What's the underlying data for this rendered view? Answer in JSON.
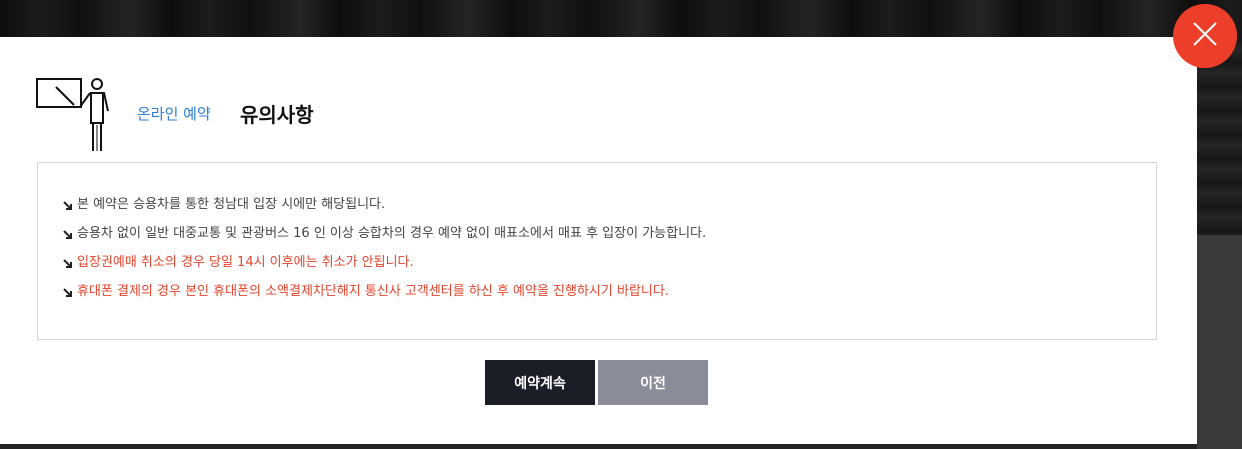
{
  "modal": {
    "section_label": "온라인 예약",
    "title": "유의사항",
    "notices": [
      {
        "text": "본 예약은 승용차를 통한 청남대 입장 시에만 해당됩니다.",
        "warning": false
      },
      {
        "text": "승용차 없이 일반 대중교통 및 관광버스 16 인 이상 승합차의 경우 예약 없이 매표소에서 매표 후 입장이 가능합니다.",
        "warning": false
      },
      {
        "text": "입장권예매 취소의 경우 당일 14시 이후에는 취소가 안됩니다.",
        "warning": true
      },
      {
        "text": "휴대폰 결제의 경우 본인 휴대폰의 소액결제차단해지 통신사 고객센터를 하신 후 예약을 진행하시기 바랍니다.",
        "warning": true
      }
    ],
    "buttons": {
      "continue_label": "예약계속",
      "prev_label": "이전"
    }
  },
  "icons": {
    "header": "presenter-icon",
    "bullet": "arrow-bullet-icon",
    "close": "close-icon"
  },
  "colors": {
    "accent_blue": "#2f7fd6",
    "warning_red": "#e2462f",
    "close_red": "#ed3e29",
    "primary_button": "#1b1d27",
    "secondary_button": "#8a8d99"
  }
}
